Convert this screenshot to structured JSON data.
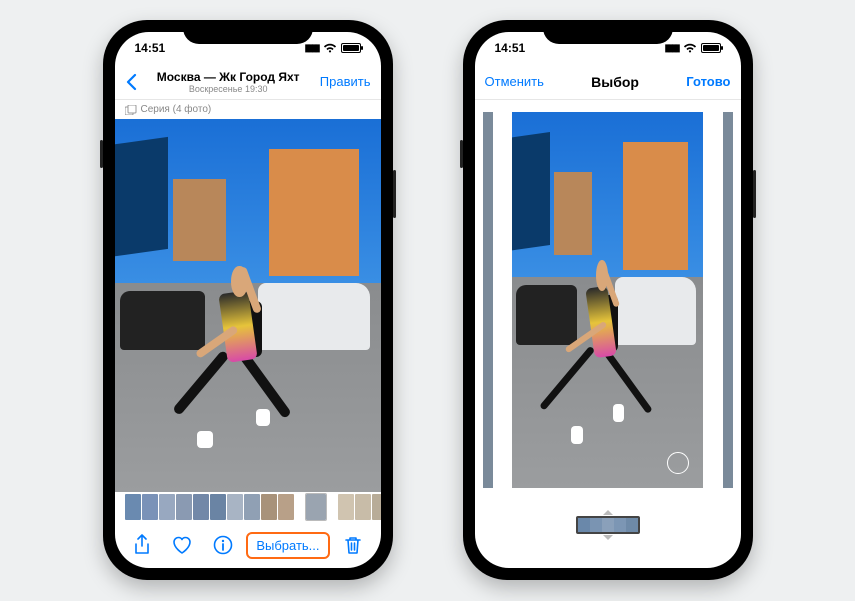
{
  "phone1": {
    "status_time": "14:51",
    "nav": {
      "title": "Москва — Жк Город Яхт",
      "subtitle": "Воскресенье 19:30",
      "edit": "Править"
    },
    "series_label": "Серия (4 фото)",
    "select_button": "Выбрать..."
  },
  "phone2": {
    "status_time": "14:51",
    "nav": {
      "cancel": "Отменить",
      "title": "Выбор",
      "done": "Готово"
    }
  },
  "colors": {
    "accent": "#007aff",
    "highlight": "#ff6a13"
  }
}
